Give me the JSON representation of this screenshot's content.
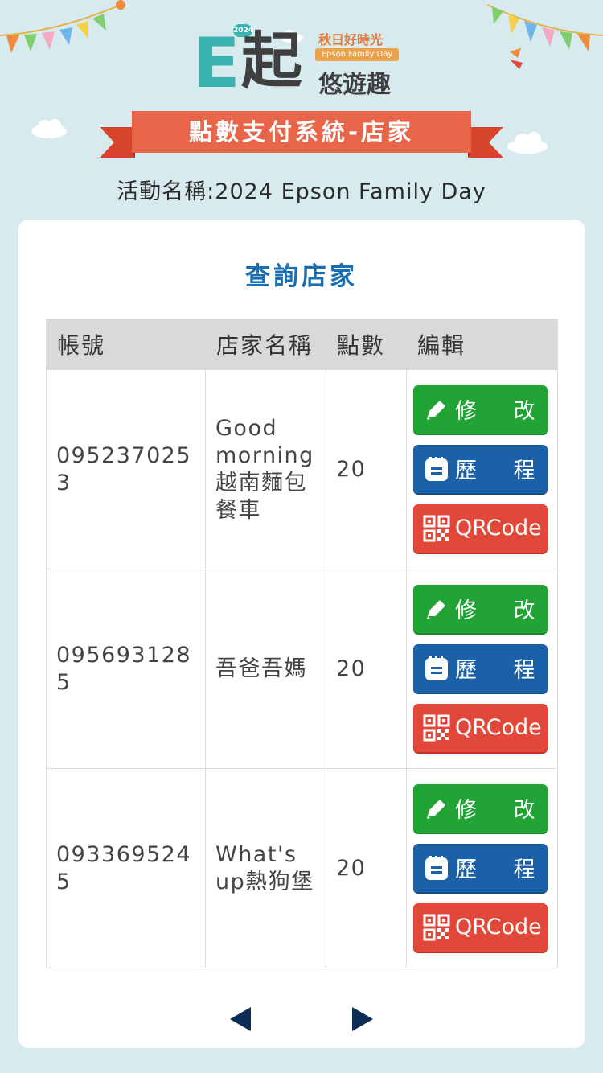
{
  "header": {
    "logo_e": "E",
    "logo_qi": "起",
    "logo_year": "2024",
    "logo_sub1": "秋日好時光",
    "logo_tag": "Epson Family Day",
    "logo_sub2": "悠遊趣",
    "banner_title": "點數支付系統-店家",
    "event_name": "活動名稱:2024 Epson Family Day"
  },
  "card": {
    "title": "查詢店家"
  },
  "table": {
    "columns": [
      "帳號",
      "店家名稱",
      "點數",
      "編輯"
    ],
    "rows": [
      {
        "account": "0952370253",
        "store": "Good morning越南麵包餐車",
        "points": "20"
      },
      {
        "account": "0956931285",
        "store": "吾爸吾媽",
        "points": "20"
      },
      {
        "account": "0933695245",
        "store": "What's up熱狗堡",
        "points": "20"
      }
    ],
    "buttons": {
      "edit": [
        "修",
        "改"
      ],
      "history": [
        "歷",
        "程"
      ],
      "qrcode": "QRCode"
    }
  },
  "pager": {
    "prev_icon": "triangle-left-icon",
    "next_icon": "triangle-right-icon"
  },
  "colors": {
    "background": "#d7eaee",
    "title_blue": "#1a6fb2",
    "ribbon": "#e8654a",
    "green_button": "#21a336",
    "blue_button": "#1b61a8",
    "red_button": "#e2483a",
    "pager": "#0d2d57"
  }
}
